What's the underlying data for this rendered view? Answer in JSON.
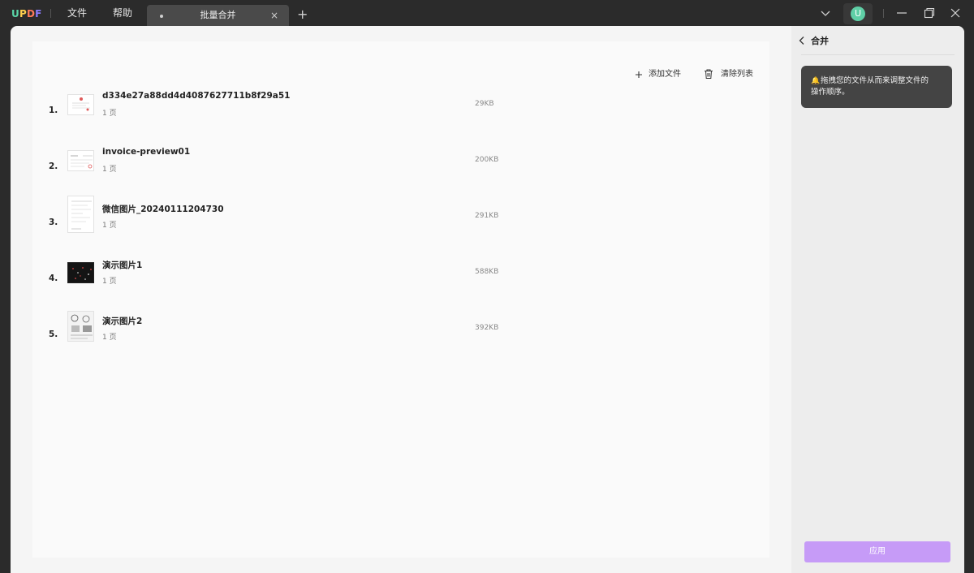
{
  "titlebar": {
    "logo": {
      "letters": [
        "U",
        "P",
        "D",
        "F"
      ],
      "colors": [
        "#5ad6a8",
        "#ffcf4d",
        "#ff7a59",
        "#8c7cff"
      ]
    },
    "menu": [
      {
        "label": "文件"
      },
      {
        "label": "帮助"
      }
    ],
    "tab": {
      "title": "批量合并",
      "close": "×"
    },
    "add_tab": "+",
    "avatar_letter": "U"
  },
  "toolbar": {
    "add_files": "添加文件",
    "clear_list": "清除列表"
  },
  "files": [
    {
      "index": "1.",
      "name": "d334e27a88dd4d4087627711b8f29a51",
      "pages": "1 页",
      "size": "29KB"
    },
    {
      "index": "2.",
      "name": "invoice-preview01",
      "pages": "1 页",
      "size": "200KB"
    },
    {
      "index": "3.",
      "name": "微信图片_20240111204730",
      "pages": "1 页",
      "size": "291KB"
    },
    {
      "index": "4.",
      "name": "演示图片1",
      "pages": "1 页",
      "size": "588KB"
    },
    {
      "index": "5.",
      "name": "演示图片2",
      "pages": "1 页",
      "size": "392KB"
    }
  ],
  "sidebar": {
    "title": "合并",
    "tip_line1": "拖拽您的文件从而来调整文件的",
    "tip_line2": "操作顺序。",
    "apply": "应用"
  },
  "colors": {
    "accent": "#c69bf7",
    "titlebar_bg": "#2b2b2b",
    "tab_bg": "#4a4a4a"
  }
}
